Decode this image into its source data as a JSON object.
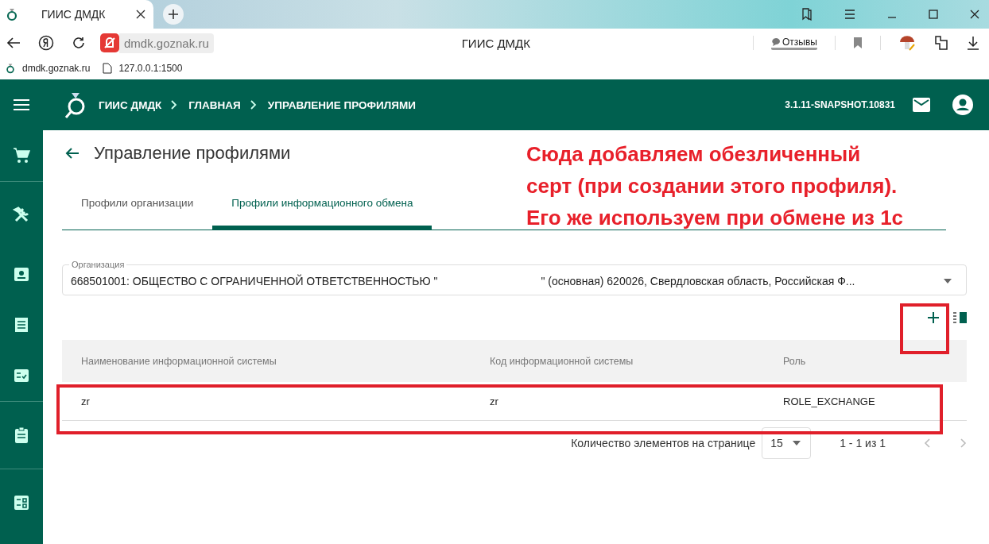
{
  "browser": {
    "tab_title": "ГИИС ДМДК",
    "address": "dmdk.goznak.ru",
    "page_title": "ГИИС ДМДК",
    "feedback": "Отзывы",
    "bookmarks": [
      "dmdk.goznak.ru",
      "127.0.0.1:1500"
    ]
  },
  "header": {
    "breadcrumbs": [
      "ГИИС ДМДК",
      "ГЛАВНАЯ",
      "УПРАВЛЕНИЕ ПРОФИЛЯМИ"
    ],
    "version": "3.1.11-SNAPSHOT.10831"
  },
  "sidebar": {
    "items": [
      {
        "kind": "cart"
      },
      {
        "kind": "tools"
      },
      {
        "kind": "badge"
      },
      {
        "kind": "receipt"
      },
      {
        "kind": "checklist"
      },
      {
        "kind": "clipboard"
      },
      {
        "kind": "dashboard"
      }
    ]
  },
  "page": {
    "title": "Управление профилями",
    "tabs": [
      {
        "label": "Профили организации",
        "selected": false
      },
      {
        "label": "Профили информационного обмена",
        "selected": true
      }
    ],
    "organization": {
      "label": "Организация",
      "value_start": "668501001: ОБЩЕСТВО С ОГРАНИЧЕННОЙ ОТВЕТСТВЕННОСТЬЮ \"",
      "value_end": "\" (основная) 620026, Свердловская область, Российская Ф..."
    },
    "table": {
      "columns": [
        "Наименование информационной системы",
        "Код информационной системы",
        "Роль"
      ],
      "rows": [
        [
          "zr",
          "zr",
          "ROLE_EXCHANGE"
        ]
      ]
    },
    "pagination": {
      "label": "Количество элементов на странице",
      "page_size": "15",
      "range": "1 - 1 из 1"
    }
  },
  "annotation": {
    "lines": [
      "Сюда добавляем обезличенный",
      "серт (при создании этого профиля).",
      "Его же используем при обмене из 1с"
    ]
  }
}
